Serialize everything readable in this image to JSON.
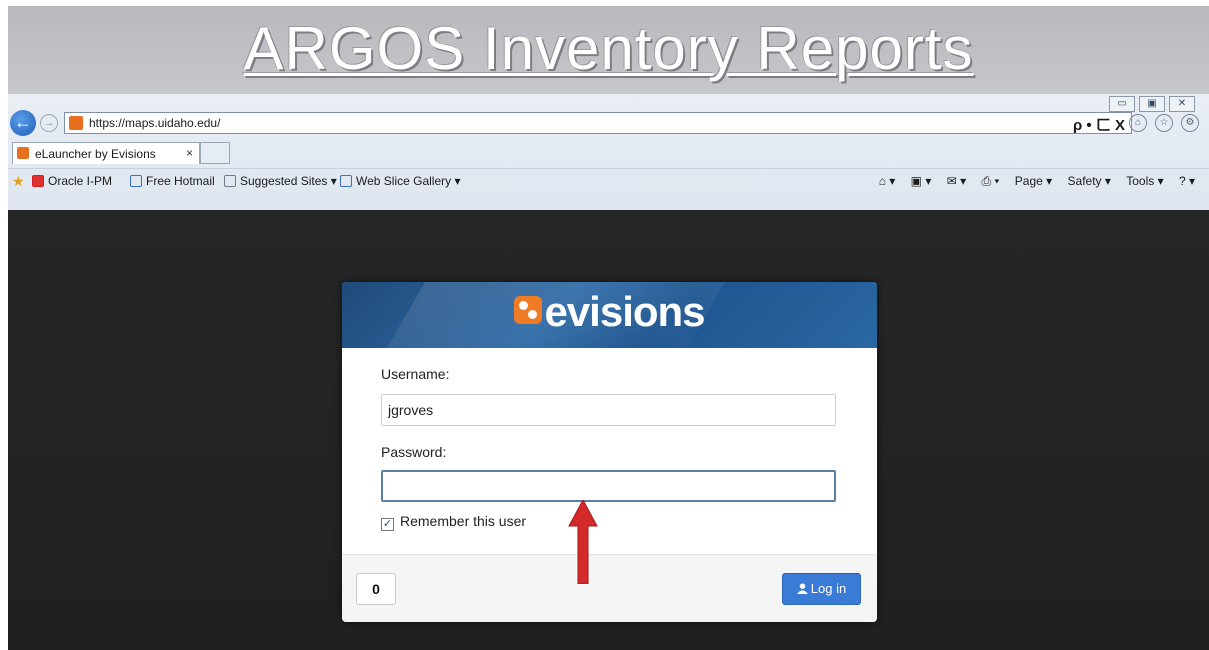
{
  "slide": {
    "title": "ARGOS Inventory Reports"
  },
  "browser": {
    "url": "https://maps.uidaho.edu/",
    "address_tools": "ρ • ㄈ X",
    "tab_label": "eLauncher by Evisions",
    "tab_close": "×",
    "favorites": [
      {
        "label": "Oracle I-PM",
        "icon": "oracle-icon"
      },
      {
        "label": "Free Hotmail",
        "icon": "ie-page-icon"
      },
      {
        "label": "Suggested Sites ▾",
        "icon": "suggested-sites-icon"
      },
      {
        "label": "Web Slice Gallery ▾",
        "icon": "ie-page-icon"
      }
    ],
    "command_bar": {
      "home": "⌂ ▾",
      "feeds": "▣ ▾",
      "mail": "✉ ▾",
      "print": "⎙ ▾",
      "page": "Page ▾",
      "safety": "Safety ▾",
      "tools": "Tools ▾",
      "help": "? ▾"
    },
    "window_controls": [
      "▭",
      "▣",
      "✕"
    ]
  },
  "login": {
    "brand": "evisions",
    "username_label": "Username:",
    "username_value": "jgroves",
    "password_label": "Password:",
    "password_value": "",
    "remember_label": "Remember this user",
    "remember_checked": "☑",
    "help_label": "0",
    "login_label": "Log in",
    "login_icon": "user-icon"
  },
  "colors": {
    "brand_orange": "#ef7b25",
    "header_blue": "#2e6aa6",
    "login_button": "#3a7bd5",
    "annotation_red": "#d42a2a"
  }
}
